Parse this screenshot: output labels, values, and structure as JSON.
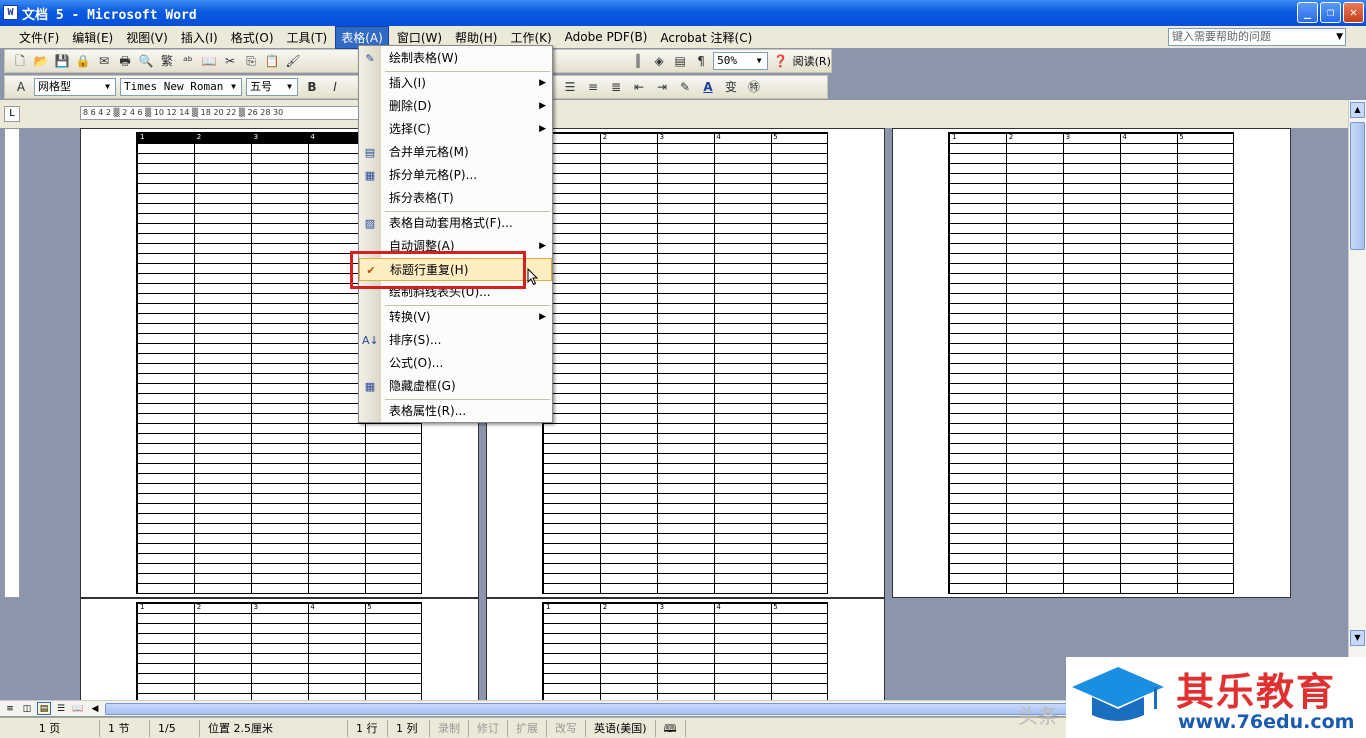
{
  "window": {
    "title": "文档 5 - Microsoft Word",
    "min": "_",
    "restore": "❐",
    "close": "✕"
  },
  "menubar": {
    "items": [
      "文件(F)",
      "编辑(E)",
      "视图(V)",
      "插入(I)",
      "格式(O)",
      "工具(T)",
      "表格(A)",
      "窗口(W)",
      "帮助(H)",
      "工作(K)",
      "Adobe PDF(B)",
      "Acrobat 注释(C)"
    ],
    "active_index": 6,
    "help_placeholder": "键入需要帮助的问题"
  },
  "toolbar": {
    "zoom": "50%",
    "read_label": "阅读(R)",
    "style": "网格型",
    "font": "Times New Roman",
    "size": "五号",
    "bold": "B",
    "italic": "I",
    "trad": "繁"
  },
  "ruler": {
    "text": "8 6 4 2 ▒ 2 4 6 ▒ 10 12 14 ▒ 18 20 22 ▒ 26 28 30"
  },
  "table_header": [
    "1",
    "2",
    "3",
    "4",
    "5"
  ],
  "table_menu": {
    "items": [
      {
        "label": "绘制表格(W)",
        "icon": "pencil-icon",
        "glyph": "✎",
        "submenu": false
      },
      {
        "label": "插入(I)",
        "icon": "",
        "glyph": "",
        "submenu": true
      },
      {
        "label": "删除(D)",
        "icon": "",
        "glyph": "",
        "submenu": true
      },
      {
        "label": "选择(C)",
        "icon": "",
        "glyph": "",
        "submenu": true
      },
      {
        "label": "合并单元格(M)",
        "icon": "merge-cells-icon",
        "glyph": "▤",
        "submenu": false
      },
      {
        "label": "拆分单元格(P)...",
        "icon": "split-cells-icon",
        "glyph": "▦",
        "submenu": false
      },
      {
        "label": "拆分表格(T)",
        "icon": "",
        "glyph": "",
        "submenu": false
      },
      {
        "label": "表格自动套用格式(F)...",
        "icon": "autoformat-icon",
        "glyph": "▨",
        "submenu": false
      },
      {
        "label": "自动调整(A)",
        "icon": "",
        "glyph": "",
        "submenu": true
      },
      {
        "label": "标题行重复(H)",
        "icon": "checkmark-icon",
        "glyph": "✔",
        "submenu": false
      },
      {
        "label": "绘制斜线表头(U)...",
        "icon": "",
        "glyph": "",
        "submenu": false
      },
      {
        "label": "转换(V)",
        "icon": "",
        "glyph": "",
        "submenu": true
      },
      {
        "label": "排序(S)...",
        "icon": "sort-icon",
        "glyph": "A↓",
        "submenu": false
      },
      {
        "label": "公式(O)...",
        "icon": "",
        "glyph": "",
        "submenu": false
      },
      {
        "label": "隐藏虚框(G)",
        "icon": "gridlines-icon",
        "glyph": "▦",
        "submenu": false
      },
      {
        "label": "表格属性(R)...",
        "icon": "",
        "glyph": "",
        "submenu": false
      }
    ],
    "highlighted_index": 9
  },
  "status": {
    "page": "1 页",
    "section": "1 节",
    "pages": "1/5",
    "position": "位置 2.5厘米",
    "line": "1 行",
    "col": "1 列",
    "rec": "录制",
    "trk": "修订",
    "ext": "扩展",
    "ovr": "改写",
    "lang": "英语(美国)"
  },
  "watermark": {
    "brand": "其乐教育",
    "url": "www.76edu.com",
    "source": "头条"
  }
}
